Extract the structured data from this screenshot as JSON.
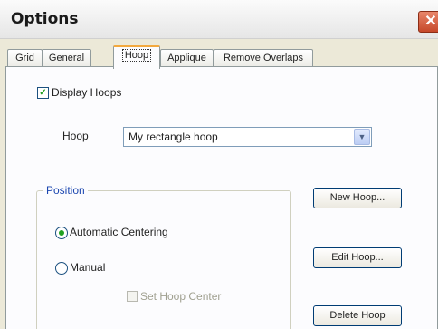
{
  "window": {
    "title": "Options",
    "close_glyph": "✕"
  },
  "tabs": [
    {
      "label": "Grid"
    },
    {
      "label": "General"
    },
    {
      "label": "Hoop"
    },
    {
      "label": "Applique"
    },
    {
      "label": "Remove Overlaps"
    }
  ],
  "hoop_tab": {
    "display_hoops": {
      "label": "Display Hoops",
      "checked": true,
      "glyph": "✓"
    },
    "hoop": {
      "label": "Hoop",
      "value": "My rectangle hoop",
      "arrow_glyph": "▼"
    },
    "position": {
      "title": "Position",
      "automatic_centering": {
        "label": "Automatic Centering",
        "selected": true
      },
      "manual": {
        "label": "Manual",
        "selected": false
      },
      "set_hoop_center": {
        "label": "Set Hoop Center",
        "enabled": false,
        "checked": false
      }
    },
    "buttons": {
      "new_hoop": "New Hoop...",
      "edit_hoop": "Edit Hoop...",
      "delete_hoop": "Delete Hoop"
    }
  },
  "colors": {
    "tab_highlight": "#f3a93e",
    "group_title": "#1c47b0",
    "check": "#21a121"
  }
}
